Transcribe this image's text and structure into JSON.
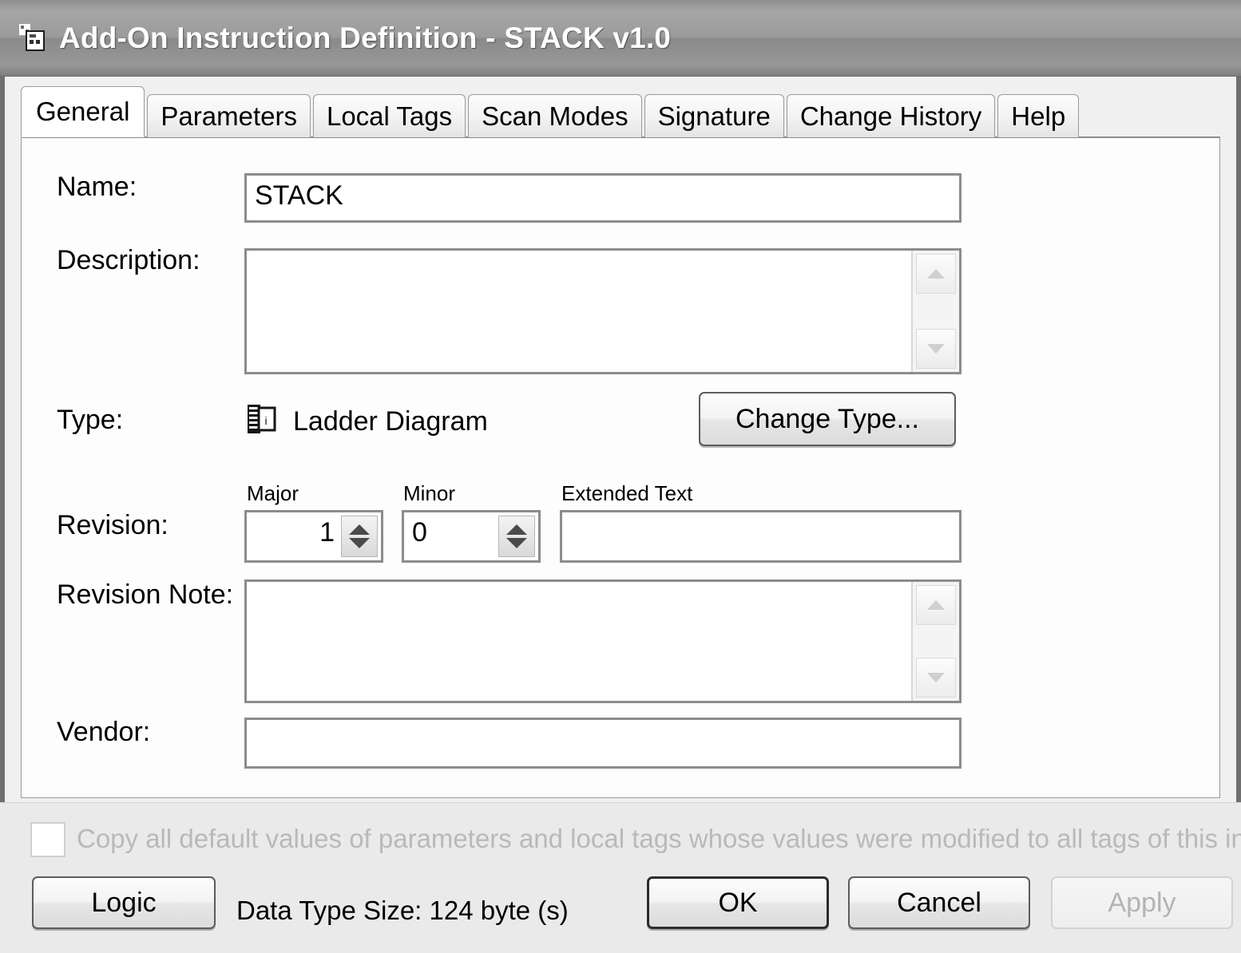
{
  "window": {
    "title": "Add-On Instruction Definition - STACK v1.0",
    "icon": "add-on-instruction-icon"
  },
  "tabs": [
    {
      "label": "General",
      "active": true
    },
    {
      "label": "Parameters",
      "active": false
    },
    {
      "label": "Local Tags",
      "active": false
    },
    {
      "label": "Scan Modes",
      "active": false
    },
    {
      "label": "Signature",
      "active": false
    },
    {
      "label": "Change History",
      "active": false
    },
    {
      "label": "Help",
      "active": false
    }
  ],
  "general": {
    "name_label": "Name:",
    "name_value": "STACK",
    "description_label": "Description:",
    "description_value": "",
    "type_label": "Type:",
    "type_value": "Ladder Diagram",
    "type_icon": "ladder-diagram-icon",
    "change_type_label": "Change Type...",
    "revision_label": "Revision:",
    "major_label": "Major",
    "major_value": "1",
    "minor_label": "Minor",
    "minor_value": "0",
    "extended_text_label": "Extended Text",
    "extended_text_value": "",
    "revision_note_label": "Revision Note:",
    "revision_note_value": "",
    "vendor_label": "Vendor:",
    "vendor_value": ""
  },
  "footer": {
    "copy_defaults_label": "Copy all default values of parameters and local tags whose values were modified to all tags of this in",
    "copy_defaults_checked": false,
    "logic_label": "Logic",
    "data_type_size": "Data Type Size: 124 byte (s)",
    "ok_label": "OK",
    "cancel_label": "Cancel",
    "apply_label": "Apply",
    "apply_enabled": false
  },
  "colors": {
    "titlebar": "#9b9b9b",
    "panel": "#fdfdfd",
    "footer": "#eaeaea",
    "field_border": "#8c8c8c",
    "disabled_text": "#b9b9b9"
  }
}
